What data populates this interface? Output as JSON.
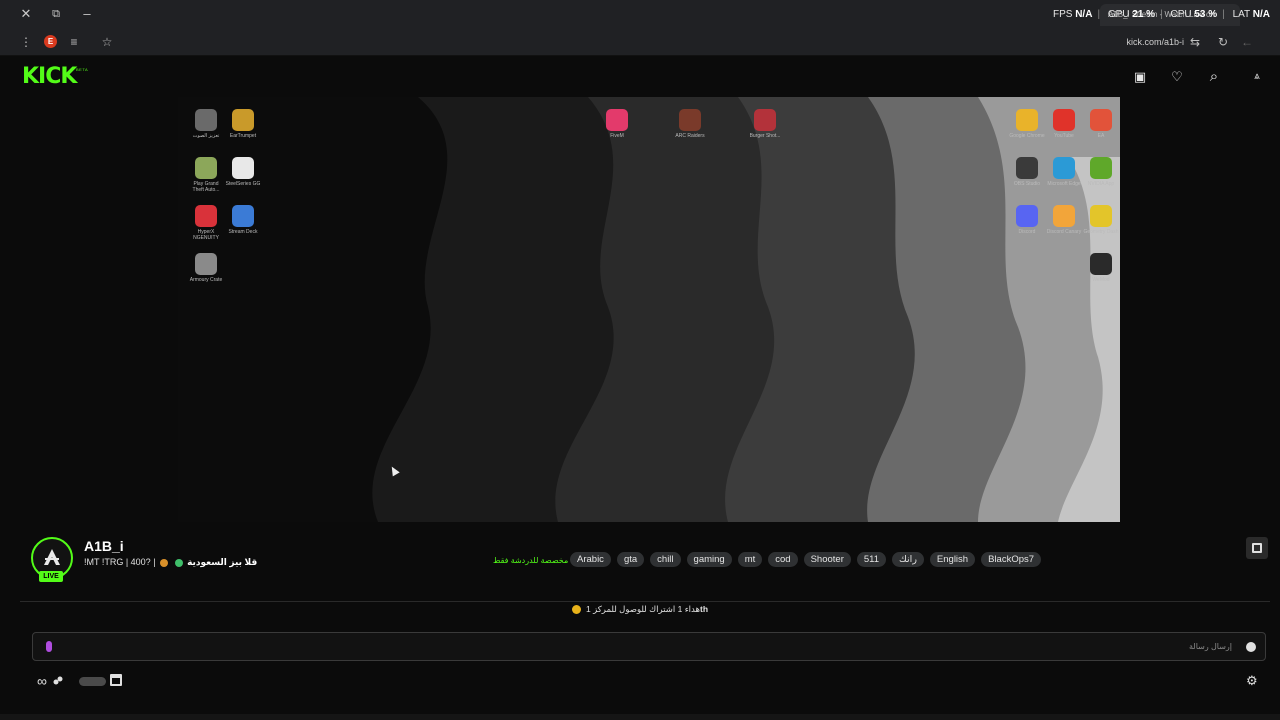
{
  "window": {
    "tab_title": "A1B_i Stream - Watch Live on",
    "overlay": {
      "fps_label": "FPS",
      "fps_value": "N/A",
      "gpu_label": "GPU",
      "gpu_value": "21 %",
      "cpu_label": "CPU",
      "cpu_value": "53 %",
      "lat_label": "LAT",
      "lat_value": "N/A"
    }
  },
  "browser": {
    "url": "kick.com/a1b-i",
    "extension_badge": "E"
  },
  "site": {
    "logo": "KICK",
    "logo_badge": "BETA"
  },
  "desktop_icons_left": [
    {
      "label": "تعزيز الصوت",
      "color": "#6a6a6a"
    },
    {
      "label": "EarTrumpet",
      "color": "#c99a2a"
    },
    {
      "label": "Play Grand Theft Auto...",
      "color": "#8ca75a"
    },
    {
      "label": "SteelSeries GG",
      "color": "#e8e8e8"
    },
    {
      "label": "HyperX NGENUITY",
      "color": "#d9323a"
    },
    {
      "label": "Stream Deck",
      "color": "#3b7bd6"
    },
    {
      "label": "Armoury Crate",
      "color": "#8a8a8a"
    }
  ],
  "desktop_icons_mid": [
    {
      "label": "FiveM",
      "color": "#e33a6b"
    },
    {
      "label": "ARC Raiders",
      "color": "#7a3a2a"
    },
    {
      "label": "Burger Shot...",
      "color": "#b3323a"
    }
  ],
  "desktop_icons_right": [
    {
      "label": "Google Chrome",
      "color": "#e9b32a"
    },
    {
      "label": "YouTube",
      "color": "#e0332a"
    },
    {
      "label": "EA",
      "color": "#e2533a"
    },
    {
      "label": "OBS Studio",
      "color": "#3a3a3a"
    },
    {
      "label": "Microsoft Edge",
      "color": "#2b9ad6"
    },
    {
      "label": "NVIDIA App",
      "color": "#5fa82a"
    },
    {
      "label": "Discord",
      "color": "#5865f2"
    },
    {
      "label": "Discord Canary",
      "color": "#f2a53a"
    },
    {
      "label": "Geometry Dash",
      "color": "#e3c52a"
    },
    {
      "label": "WeMod",
      "color": "#2a2a2a"
    }
  ],
  "stream": {
    "streamer_name": "A1B_i",
    "live_badge": "LIVE",
    "title_prefix": "!MT !TRG | 400? |",
    "title_arabic": "قلا بيز السعودية",
    "category_link": "مخصصة للدردشة فقط",
    "tags": [
      "Arabic",
      "gta",
      "chill",
      "gaming",
      "mt",
      "cod",
      "Shooter",
      "511",
      "رانك",
      "English",
      "BlackOps7"
    ]
  },
  "chat": {
    "banner_text": "هداء 1 اشتراك للوصول للمركز 1",
    "banner_suffix": "th",
    "input_placeholder": "إرسال رسالة"
  }
}
